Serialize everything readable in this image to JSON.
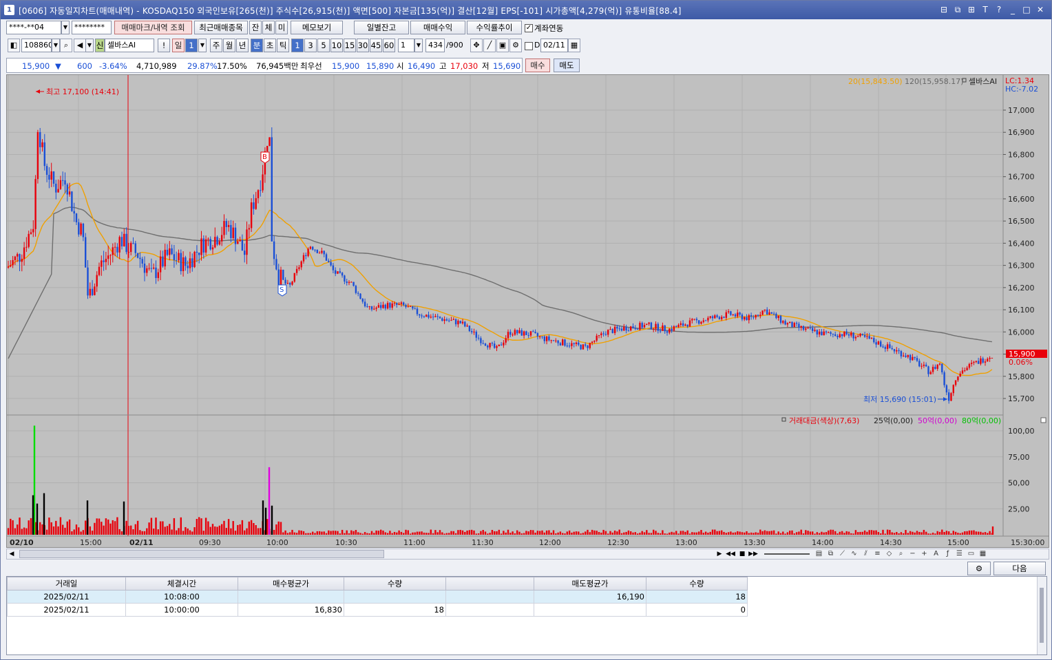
{
  "window": {
    "icon_label": "1",
    "title": "[0606] 자동일지차트(매매내역) - KOSDAQ150 외국인보유[265(천)] 주식수[26,915(천)] 액면[500] 자본금[135(억)] 결산[12월] EPS[-101] 시가총액[4,279(억)] 유통비율[88.4]",
    "buttons": [
      "⊟",
      "⧉",
      "⊞",
      "T",
      "?",
      "_",
      "□",
      "✕"
    ]
  },
  "toolbar1": {
    "account": "****-**04",
    "password": "********",
    "trade_mark_btn": "매매마크/내역 조회",
    "recent_trades_btn": "최근매매종목",
    "tab_jan": "잔",
    "tab_che": "체",
    "tab_mi": "미",
    "memo_btn": "메모보기",
    "daily_balance_btn": "일별잔고",
    "trade_profit_btn": "매매수익",
    "profit_trend_btn": "수익률추이",
    "account_link_label": "계좌연동",
    "account_link_checked": true
  },
  "toolbar2": {
    "code": "108860",
    "credit_badge": "신",
    "stock_name": "셀바스AI",
    "warn_icon": "!",
    "period_day": "일",
    "period_num": "1",
    "period_week": "주",
    "period_month": "월",
    "period_year": "년",
    "period_min": "분",
    "period_sec": "초",
    "period_tick": "틱",
    "intervals": [
      "1",
      "3",
      "5",
      "10",
      "15",
      "30",
      "45",
      "60"
    ],
    "interval_custom": "1",
    "count": "434",
    "count_max": "/900",
    "d_label": "D",
    "date": "02/11"
  },
  "quote": {
    "price": "15,900",
    "change_arrow": "▼",
    "change": "600",
    "change_pct": "-3.64%",
    "volume": "4,710,989",
    "vol_ratio": "29.87%",
    "rate2": "17.50%",
    "amount": "76,945백만",
    "best_label": "최우선",
    "best_ask": "15,900",
    "best_bid": "15,890",
    "open_label": "시",
    "open": "16,490",
    "high_label": "고",
    "high": "17,030",
    "low_label": "저",
    "low": "15,690",
    "buy_btn": "매수",
    "sell_btn": "매도"
  },
  "chart_data": {
    "type": "candlestick",
    "legend_ma20": "20(15,843.50)",
    "legend_ma120": "120(15,958.17)",
    "legend_stock": "셀바스AI",
    "lc": "LC:1.34",
    "hc": "HC:-7.02",
    "price_ticks": [
      "17,000",
      "16,900",
      "16,800",
      "16,700",
      "16,600",
      "16,500",
      "16,400",
      "16,300",
      "16,200",
      "16,100",
      "16,000",
      "15,900",
      "15,800",
      "15,700"
    ],
    "price_ticks_values": [
      17000,
      16900,
      16800,
      16700,
      16600,
      16500,
      16400,
      16300,
      16200,
      16100,
      16000,
      15900,
      15800,
      15700
    ],
    "current_price_tag": "15,900",
    "current_pct_tag": "0.06%",
    "high_annot": "최고 17,100 (14:41)",
    "low_annot": "최저 15,690 (15:01)",
    "buy_marker": "B",
    "sell_marker": "S",
    "colors": {
      "up": "#e8000b",
      "down": "#1a4fd6",
      "ma20": "#f0a000",
      "ma120": "#6e6e6e",
      "bg": "#c0c0c0"
    },
    "volume_legend": {
      "label": "거래대금(색상)(7,63)",
      "s25": "25억(0,00)",
      "s50": "50억(0,00)",
      "s80": "80억(0,00)"
    },
    "volume_ticks": [
      "100,00",
      "75,00",
      "50,00",
      "25,00"
    ],
    "volume_ticks_values": [
      100,
      75,
      50,
      25
    ],
    "x_labels": [
      "02/10",
      "15:00",
      "02/11",
      "09:30",
      "10:00",
      "10:30",
      "11:00",
      "11:30",
      "12:00",
      "12:30",
      "13:00",
      "13:30",
      "14:00",
      "14:30",
      "15:00",
      "15:30:00"
    ]
  },
  "bottom": {
    "next_btn": "다음"
  },
  "table": {
    "headers": [
      "거래일",
      "체결시간",
      "매수평균가",
      "수량",
      "",
      "매도평균가",
      "수량"
    ],
    "rows": [
      [
        "2025/02/11",
        "10:08:00",
        "",
        "",
        "",
        "16,190",
        "18"
      ],
      [
        "2025/02/11",
        "10:00:00",
        "16,830",
        "18",
        "",
        "",
        "0"
      ]
    ]
  }
}
